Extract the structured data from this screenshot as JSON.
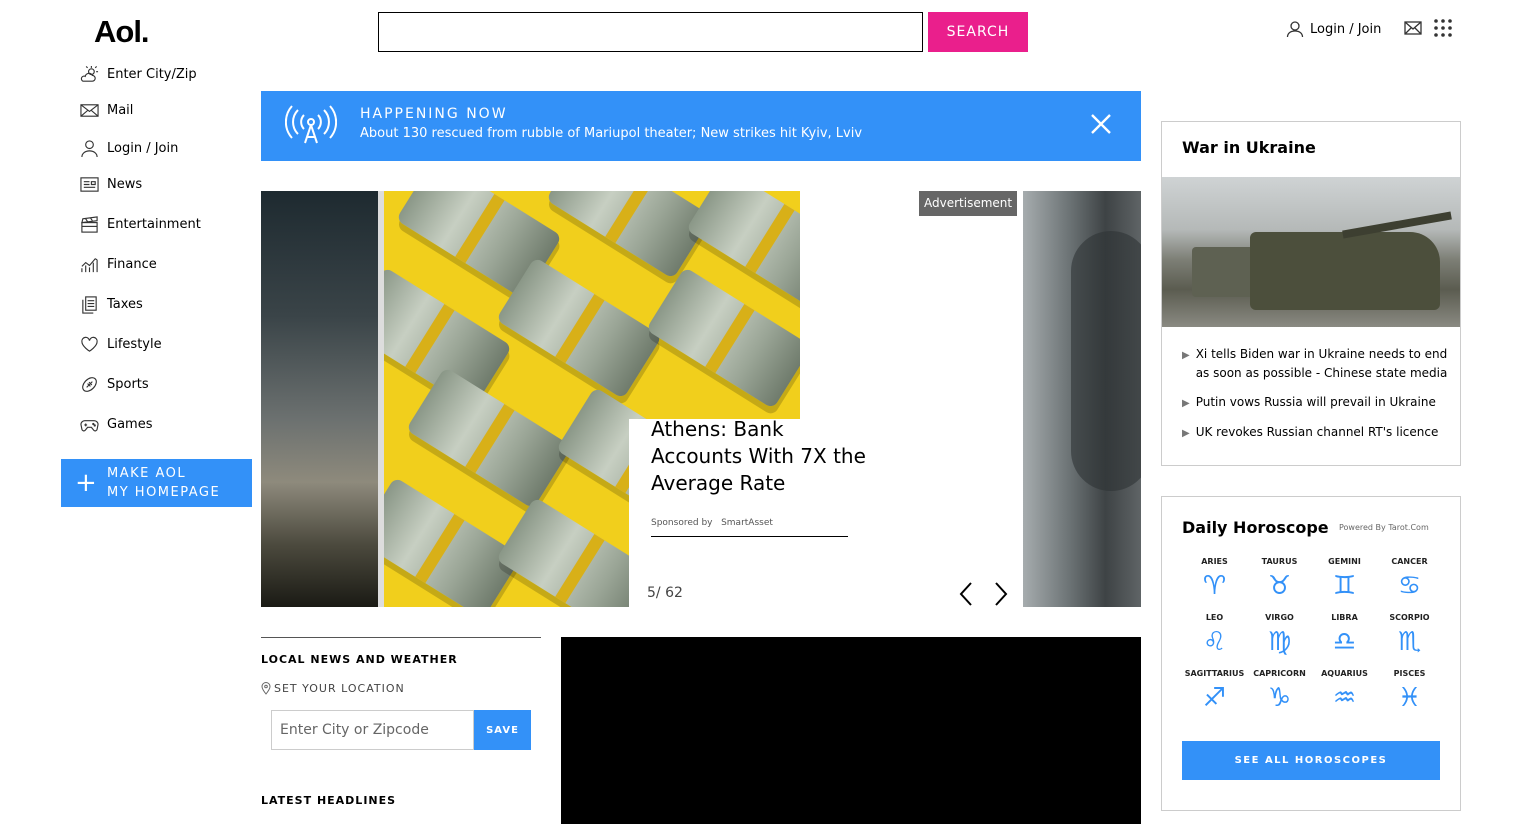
{
  "header": {
    "logo": "Aol.",
    "search_placeholder": "",
    "search_label": "SEARCH",
    "login_label": "Login / Join",
    "brand_color": "#ea1f8c"
  },
  "sidebar": {
    "items": [
      {
        "label": "Enter City/Zip",
        "icon": "weather-icon"
      },
      {
        "label": "Mail",
        "icon": "mail-icon"
      },
      {
        "label": "Login / Join",
        "icon": "user-icon"
      },
      {
        "label": "News",
        "icon": "news-icon"
      },
      {
        "label": "Entertainment",
        "icon": "clapperboard-icon"
      },
      {
        "label": "Finance",
        "icon": "chart-icon"
      },
      {
        "label": "Taxes",
        "icon": "documents-icon"
      },
      {
        "label": "Lifestyle",
        "icon": "heart-icon"
      },
      {
        "label": "Sports",
        "icon": "football-icon"
      },
      {
        "label": "Games",
        "icon": "gamepad-icon"
      }
    ],
    "make_homepage_line1": "MAKE AOL",
    "make_homepage_line2": "MY HOMEPAGE",
    "plus": "+"
  },
  "happening": {
    "title": "HAPPENING NOW",
    "text": "About 130 rescued from rubble of Mariupol theater; New strikes hit Kyiv, Lviv",
    "color": "#3391f8"
  },
  "carousel": {
    "headline": "Athens: Bank Accounts With 7X the Average Rate",
    "sponsored_by": "Sponsored by",
    "sponsor": "SmartAsset",
    "counter": "5/ 62",
    "ad_label": "Advertisement"
  },
  "local": {
    "title": "LOCAL NEWS AND WEATHER",
    "set_location": "SET YOUR LOCATION",
    "zip_placeholder": "Enter City or Zipcode",
    "save_label": "SAVE",
    "latest": "LATEST HEADLINES"
  },
  "war": {
    "title": "War in Ukraine",
    "headlines": [
      "Xi tells Biden war in Ukraine needs to end as soon as possible - Chinese state media",
      "Putin vows Russia will prevail in Ukraine",
      "UK revokes Russian channel RT's licence"
    ]
  },
  "horoscope": {
    "title": "Daily Horoscope",
    "powered": "Powered By Tarot.Com",
    "signs": [
      {
        "name": "ARIES",
        "symbol": "♈"
      },
      {
        "name": "TAURUS",
        "symbol": "♉"
      },
      {
        "name": "GEMINI",
        "symbol": "♊"
      },
      {
        "name": "CANCER",
        "symbol": "♋"
      },
      {
        "name": "LEO",
        "symbol": "♌"
      },
      {
        "name": "VIRGO",
        "symbol": "♍"
      },
      {
        "name": "LIBRA",
        "symbol": "♎"
      },
      {
        "name": "SCORPIO",
        "symbol": "♏"
      },
      {
        "name": "SAGITTARIUS",
        "symbol": "♐"
      },
      {
        "name": "CAPRICORN",
        "symbol": "♑"
      },
      {
        "name": "AQUARIUS",
        "symbol": "♒"
      },
      {
        "name": "PISCES",
        "symbol": "♓"
      }
    ],
    "see_all": "SEE ALL HOROSCOPES"
  }
}
